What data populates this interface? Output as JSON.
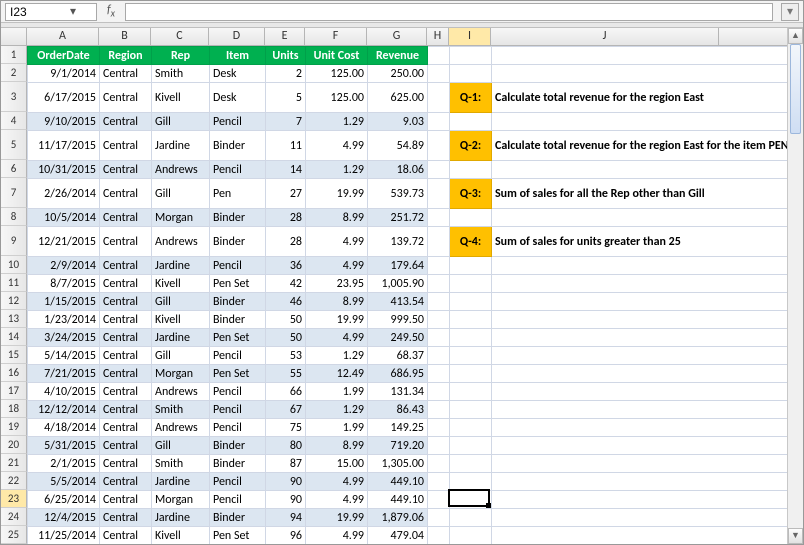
{
  "nameBox": "I23",
  "formula": "",
  "colHeaders": [
    "A",
    "B",
    "C",
    "D",
    "E",
    "F",
    "G",
    "H",
    "I",
    "J"
  ],
  "selectedCell": {
    "col": "I",
    "row": 23
  },
  "tableHeader": {
    "A": "OrderDate",
    "B": "Region",
    "C": "Rep",
    "D": "Item",
    "E": "Units",
    "F": "Unit Cost",
    "G": "Revenue"
  },
  "rows": [
    {
      "n": 2,
      "A": "9/1/2014",
      "B": "Central",
      "C": "Smith",
      "D": "Desk",
      "E": "2",
      "F": "125.00",
      "G": "250.00",
      "stripe": false,
      "tall": false
    },
    {
      "n": 3,
      "A": "6/17/2015",
      "B": "Central",
      "C": "Kivell",
      "D": "Desk",
      "E": "5",
      "F": "125.00",
      "G": "625.00",
      "stripe": false,
      "tall": true
    },
    {
      "n": 4,
      "A": "9/10/2015",
      "B": "Central",
      "C": "Gill",
      "D": "Pencil",
      "E": "7",
      "F": "1.29",
      "G": "9.03",
      "stripe": true,
      "tall": false
    },
    {
      "n": 5,
      "A": "11/17/2015",
      "B": "Central",
      "C": "Jardine",
      "D": "Binder",
      "E": "11",
      "F": "4.99",
      "G": "54.89",
      "stripe": false,
      "tall": true
    },
    {
      "n": 6,
      "A": "10/31/2015",
      "B": "Central",
      "C": "Andrews",
      "D": "Pencil",
      "E": "14",
      "F": "1.29",
      "G": "18.06",
      "stripe": true,
      "tall": false
    },
    {
      "n": 7,
      "A": "2/26/2014",
      "B": "Central",
      "C": "Gill",
      "D": "Pen",
      "E": "27",
      "F": "19.99",
      "G": "539.73",
      "stripe": false,
      "tall": true
    },
    {
      "n": 8,
      "A": "10/5/2014",
      "B": "Central",
      "C": "Morgan",
      "D": "Binder",
      "E": "28",
      "F": "8.99",
      "G": "251.72",
      "stripe": true,
      "tall": false
    },
    {
      "n": 9,
      "A": "12/21/2015",
      "B": "Central",
      "C": "Andrews",
      "D": "Binder",
      "E": "28",
      "F": "4.99",
      "G": "139.72",
      "stripe": false,
      "tall": true
    },
    {
      "n": 10,
      "A": "2/9/2014",
      "B": "Central",
      "C": "Jardine",
      "D": "Pencil",
      "E": "36",
      "F": "4.99",
      "G": "179.64",
      "stripe": true,
      "tall": false
    },
    {
      "n": 11,
      "A": "8/7/2015",
      "B": "Central",
      "C": "Kivell",
      "D": "Pen Set",
      "E": "42",
      "F": "23.95",
      "G": "1,005.90",
      "stripe": false,
      "tall": false
    },
    {
      "n": 12,
      "A": "1/15/2015",
      "B": "Central",
      "C": "Gill",
      "D": "Binder",
      "E": "46",
      "F": "8.99",
      "G": "413.54",
      "stripe": true,
      "tall": false
    },
    {
      "n": 13,
      "A": "1/23/2014",
      "B": "Central",
      "C": "Kivell",
      "D": "Binder",
      "E": "50",
      "F": "19.99",
      "G": "999.50",
      "stripe": false,
      "tall": false
    },
    {
      "n": 14,
      "A": "3/24/2015",
      "B": "Central",
      "C": "Jardine",
      "D": "Pen Set",
      "E": "50",
      "F": "4.99",
      "G": "249.50",
      "stripe": true,
      "tall": false
    },
    {
      "n": 15,
      "A": "5/14/2015",
      "B": "Central",
      "C": "Gill",
      "D": "Pencil",
      "E": "53",
      "F": "1.29",
      "G": "68.37",
      "stripe": false,
      "tall": false
    },
    {
      "n": 16,
      "A": "7/21/2015",
      "B": "Central",
      "C": "Morgan",
      "D": "Pen Set",
      "E": "55",
      "F": "12.49",
      "G": "686.95",
      "stripe": true,
      "tall": false
    },
    {
      "n": 17,
      "A": "4/10/2015",
      "B": "Central",
      "C": "Andrews",
      "D": "Pencil",
      "E": "66",
      "F": "1.99",
      "G": "131.34",
      "stripe": false,
      "tall": false
    },
    {
      "n": 18,
      "A": "12/12/2014",
      "B": "Central",
      "C": "Smith",
      "D": "Pencil",
      "E": "67",
      "F": "1.29",
      "G": "86.43",
      "stripe": true,
      "tall": false
    },
    {
      "n": 19,
      "A": "4/18/2014",
      "B": "Central",
      "C": "Andrews",
      "D": "Pencil",
      "E": "75",
      "F": "1.99",
      "G": "149.25",
      "stripe": false,
      "tall": false
    },
    {
      "n": 20,
      "A": "5/31/2015",
      "B": "Central",
      "C": "Gill",
      "D": "Binder",
      "E": "80",
      "F": "8.99",
      "G": "719.20",
      "stripe": true,
      "tall": false
    },
    {
      "n": 21,
      "A": "2/1/2015",
      "B": "Central",
      "C": "Smith",
      "D": "Binder",
      "E": "87",
      "F": "15.00",
      "G": "1,305.00",
      "stripe": false,
      "tall": false
    },
    {
      "n": 22,
      "A": "5/5/2014",
      "B": "Central",
      "C": "Jardine",
      "D": "Pencil",
      "E": "90",
      "F": "4.99",
      "G": "449.10",
      "stripe": true,
      "tall": false
    },
    {
      "n": 23,
      "A": "6/25/2014",
      "B": "Central",
      "C": "Morgan",
      "D": "Pencil",
      "E": "90",
      "F": "4.99",
      "G": "449.10",
      "stripe": false,
      "tall": false
    },
    {
      "n": 24,
      "A": "12/4/2015",
      "B": "Central",
      "C": "Jardine",
      "D": "Binder",
      "E": "94",
      "F": "19.99",
      "G": "1,879.06",
      "stripe": true,
      "tall": false
    },
    {
      "n": 25,
      "A": "11/25/2014",
      "B": "Central",
      "C": "Kivell",
      "D": "Pen Set",
      "E": "96",
      "F": "4.99",
      "G": "479.04",
      "stripe": false,
      "tall": false
    }
  ],
  "questions": [
    {
      "row": 3,
      "badge": "Q-1:",
      "text": "Calculate total revenue for the region East"
    },
    {
      "row": 5,
      "badge": "Q-2:",
      "text": "Calculate total revenue for the region East for the item PEN"
    },
    {
      "row": 7,
      "badge": "Q-3:",
      "text": "Sum of sales for all the Rep other than Gill"
    },
    {
      "row": 9,
      "badge": "Q-4:",
      "text": "Sum of sales for units greater than 25"
    }
  ]
}
